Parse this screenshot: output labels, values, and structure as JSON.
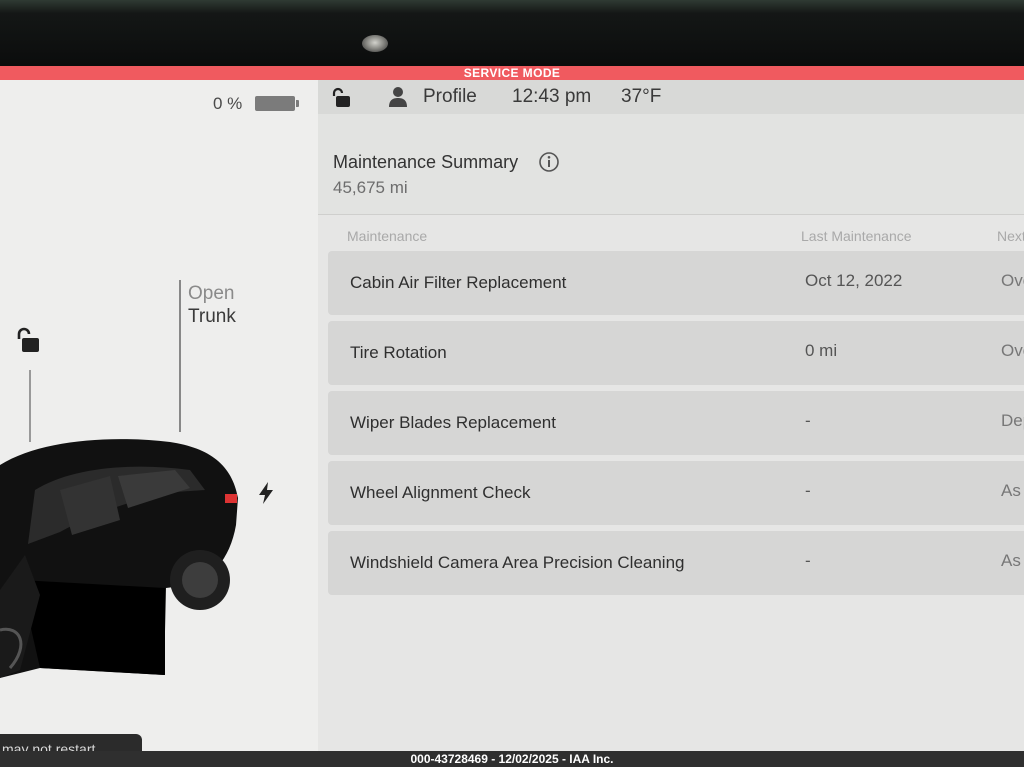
{
  "banner": {
    "text": "SERVICE MODE"
  },
  "left": {
    "battery_percent": "0 %",
    "trunk": {
      "action": "Open",
      "name": "Trunk"
    },
    "notice": "may not restart"
  },
  "status": {
    "profile": "Profile",
    "time": "12:43 pm",
    "temperature": "37°F"
  },
  "summary": {
    "title": "Maintenance Summary",
    "odometer": "45,675  mi"
  },
  "table": {
    "columns": [
      "Maintenance",
      "Last Maintenance",
      "Next"
    ],
    "rows": [
      {
        "name": "Cabin Air Filter Replacement",
        "last": "Oct 12, 2022",
        "next": "Overdue"
      },
      {
        "name": "Tire Rotation",
        "last": "0 mi",
        "next": "Overdue"
      },
      {
        "name": "Wiper Blades Replacement",
        "last": "-",
        "next": "Depends"
      },
      {
        "name": "Wheel Alignment Check",
        "last": "-",
        "next": "As needed"
      },
      {
        "name": "Windshield Camera Area Precision Cleaning",
        "last": "-",
        "next": "As needed"
      }
    ]
  },
  "watermark": "000-43728469 - 12/02/2025 - IAA Inc.",
  "icons": {
    "lock": "unlocked-padlock-icon",
    "profile": "person-icon",
    "info": "info-icon",
    "charge": "lightning-bolt-icon"
  },
  "colors": {
    "service_banner": "#f05a5f",
    "screen_bg": "#ececeb",
    "row_bg": "#d6d6d5"
  }
}
